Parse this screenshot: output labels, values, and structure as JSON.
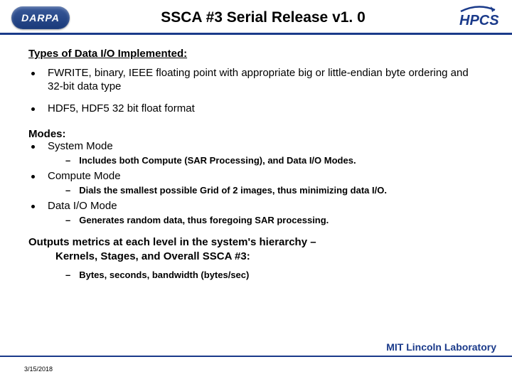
{
  "header": {
    "logo_left_text": "DARPA",
    "title": "SSCA #3 Serial Release v1. 0",
    "logo_right_text": "HPCS"
  },
  "section1": {
    "heading": "Types of Data I/O Implemented:",
    "items": [
      "FWRITE, binary, IEEE floating point with appropriate big or little-endian byte ordering and 32-bit data type",
      "HDF5, HDF5 32 bit float format"
    ]
  },
  "section2": {
    "heading": "Modes:",
    "items": [
      {
        "label": "System Mode",
        "sub": "Includes both Compute (SAR Processing), and Data I/O Modes."
      },
      {
        "label": "Compute Mode",
        "sub": "Dials the smallest possible Grid of 2 images, thus minimizing data I/O."
      },
      {
        "label": "Data I/O Mode",
        "sub": "Generates random data, thus foregoing SAR processing."
      }
    ]
  },
  "outputs": {
    "line1": "Outputs metrics at each level in the system's hierarchy –",
    "line2": "Kernels, Stages, and Overall SSCA #3:",
    "sub": "Bytes, seconds, bandwidth (bytes/sec)"
  },
  "footer": {
    "lab": "MIT Lincoln Laboratory",
    "date": "3/15/2018"
  }
}
